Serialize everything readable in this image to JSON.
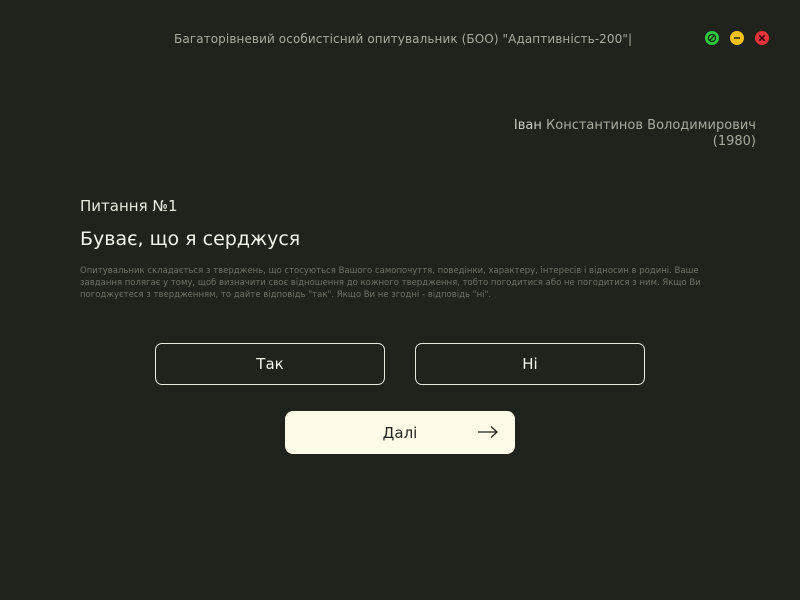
{
  "window": {
    "title": "Багаторівневий особистісний опитувальник (БОО) \"Адаптивність-200\"|",
    "controls": {
      "maximize_icon": "maximize-icon",
      "minimize_icon": "minimize-icon",
      "close_icon": "close-icon"
    }
  },
  "user": {
    "first_name": "Іван",
    "rest_name": "Константинов Володимирович",
    "birth_year": "(1980)"
  },
  "question": {
    "number_label": "Питання №1",
    "text": "Буває, що я серджуся",
    "instructions": "Опитувальник складається з тверджень, що стосуються Вашого самопочуття, поведінки, характеру, інтересів і відносин в родині. Ваше завдання полягає у тому, щоб визначити своє відношення до кожного твердження, тобто погодитися або не погодитися з ним. Якщо Ви погоджуєтеся з твердженням, то дайте відповідь \"так\". Якщо Ви не згодні - відповідь \"ні\"."
  },
  "answers": {
    "yes_label": "Так",
    "no_label": "Ні"
  },
  "navigation": {
    "next_label": "Далі",
    "next_icon": "arrow-right-icon"
  },
  "colors": {
    "background": "#1f231c",
    "button_light": "#fefbe8",
    "close": "#e8333a",
    "minimize": "#f2c316",
    "maximize": "#2ecc40"
  }
}
